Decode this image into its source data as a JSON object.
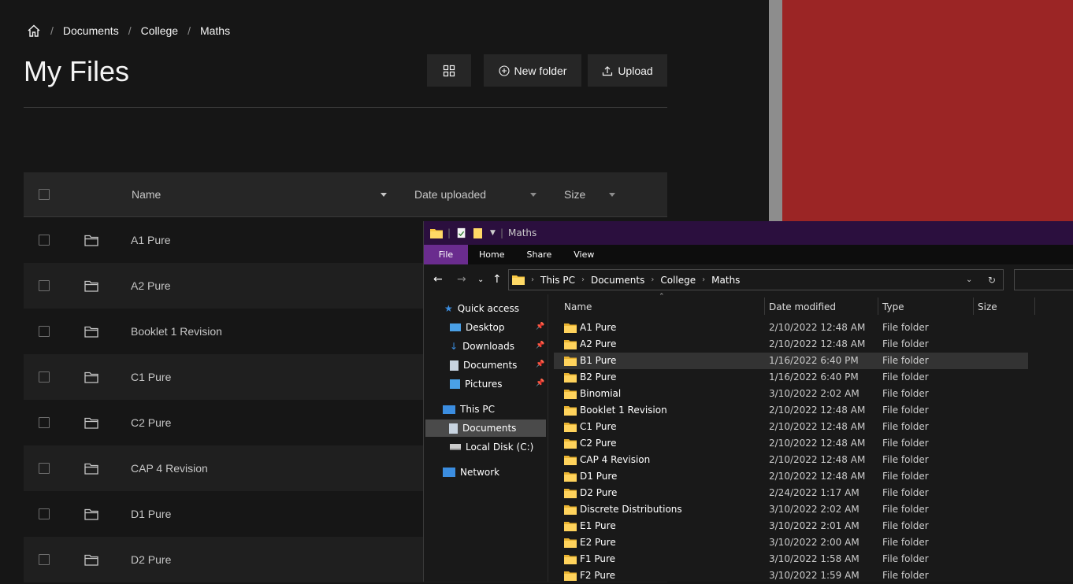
{
  "web": {
    "breadcrumb": [
      "Documents",
      "College",
      "Maths"
    ],
    "title": "My Files",
    "buttons": {
      "new_folder": "New folder",
      "upload": "Upload"
    },
    "table": {
      "headers": {
        "name": "Name",
        "date": "Date uploaded",
        "size": "Size"
      },
      "rows": [
        "A1 Pure",
        "A2 Pure",
        "Booklet 1 Revision",
        "C1 Pure",
        "C2 Pure",
        "CAP 4 Revision",
        "D1 Pure",
        "D2 Pure"
      ]
    }
  },
  "explorer": {
    "title": "Maths",
    "tabs": [
      "File",
      "Home",
      "Share",
      "View"
    ],
    "address": [
      "This PC",
      "Documents",
      "College",
      "Maths"
    ],
    "nav": {
      "quick_access": "Quick access",
      "desktop": "Desktop",
      "downloads": "Downloads",
      "documents": "Documents",
      "pictures": "Pictures",
      "this_pc": "This PC",
      "documents2": "Documents",
      "local_disk": "Local Disk (C:)",
      "network": "Network"
    },
    "columns": {
      "name": "Name",
      "date": "Date modified",
      "type": "Type",
      "size": "Size"
    },
    "rows": [
      {
        "name": "A1 Pure",
        "date": "2/10/2022 12:48 AM",
        "type": "File folder"
      },
      {
        "name": "A2 Pure",
        "date": "2/10/2022 12:48 AM",
        "type": "File folder"
      },
      {
        "name": "B1 Pure",
        "date": "1/16/2022 6:40 PM",
        "type": "File folder"
      },
      {
        "name": "B2 Pure",
        "date": "1/16/2022 6:40 PM",
        "type": "File folder"
      },
      {
        "name": "Binomial",
        "date": "3/10/2022 2:02 AM",
        "type": "File folder"
      },
      {
        "name": "Booklet 1 Revision",
        "date": "2/10/2022 12:48 AM",
        "type": "File folder"
      },
      {
        "name": "C1 Pure",
        "date": "2/10/2022 12:48 AM",
        "type": "File folder"
      },
      {
        "name": "C2 Pure",
        "date": "2/10/2022 12:48 AM",
        "type": "File folder"
      },
      {
        "name": "CAP 4 Revision",
        "date": "2/10/2022 12:48 AM",
        "type": "File folder"
      },
      {
        "name": "D1 Pure",
        "date": "2/10/2022 12:48 AM",
        "type": "File folder"
      },
      {
        "name": "D2 Pure",
        "date": "2/24/2022 1:17 AM",
        "type": "File folder"
      },
      {
        "name": "Discrete Distributions",
        "date": "3/10/2022 2:02 AM",
        "type": "File folder"
      },
      {
        "name": "E1 Pure",
        "date": "3/10/2022 2:01 AM",
        "type": "File folder"
      },
      {
        "name": "E2 Pure",
        "date": "3/10/2022 2:00 AM",
        "type": "File folder"
      },
      {
        "name": "F1 Pure",
        "date": "3/10/2022 1:58 AM",
        "type": "File folder"
      },
      {
        "name": "F2 Pure",
        "date": "3/10/2022 1:59 AM",
        "type": "File folder"
      }
    ]
  }
}
